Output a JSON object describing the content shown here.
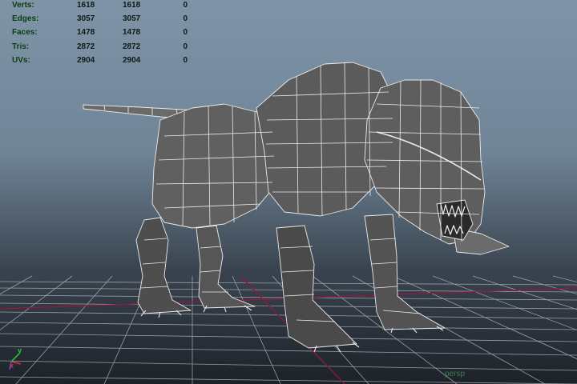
{
  "heads_up": {
    "rows": [
      {
        "label": "Verts:",
        "c1": "1618",
        "c2": "1618",
        "c3": "0"
      },
      {
        "label": "Edges:",
        "c1": "3057",
        "c2": "3057",
        "c3": "0"
      },
      {
        "label": "Faces:",
        "c1": "1478",
        "c2": "1478",
        "c3": "0"
      },
      {
        "label": "Tris:",
        "c1": "2872",
        "c2": "2872",
        "c3": "0"
      },
      {
        "label": "UVs:",
        "c1": "2904",
        "c2": "2904",
        "c3": "0"
      }
    ]
  },
  "axis_gizmo": {
    "y": "y",
    "x": "x"
  },
  "camera": {
    "name": "persp"
  },
  "colors": {
    "grid": "#b9bfc6",
    "grid_axis": "#8a1a3a",
    "mesh_fill": "#5a5a5a",
    "wire": "#e8e8e8"
  }
}
